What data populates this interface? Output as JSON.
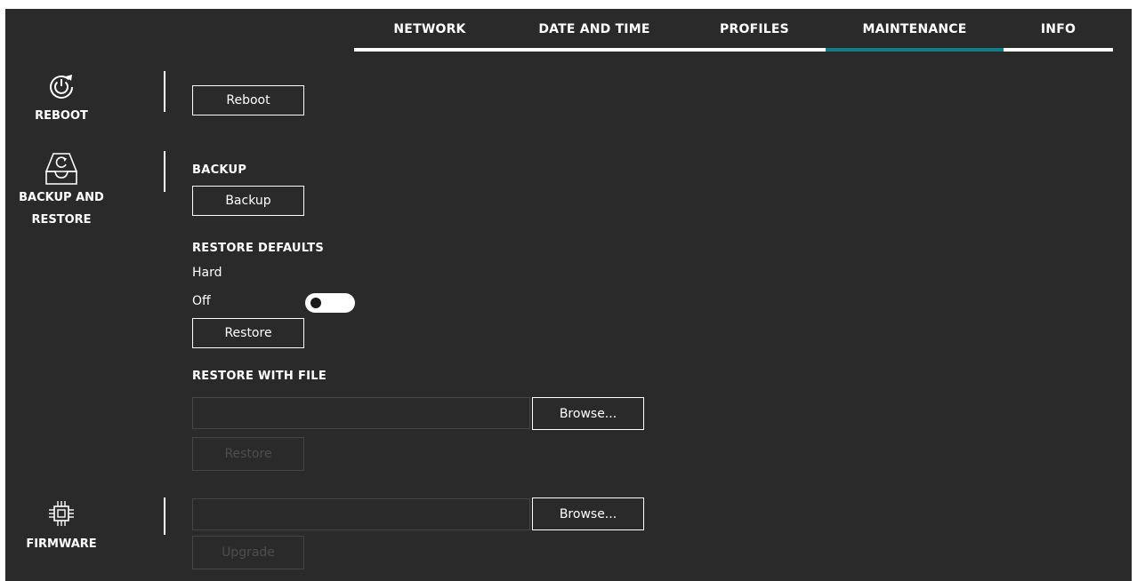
{
  "tabs": [
    {
      "label": "NETWORK",
      "active": false
    },
    {
      "label": "DATE AND TIME",
      "active": false
    },
    {
      "label": "PROFILES",
      "active": false
    },
    {
      "label": "MAINTENANCE",
      "active": true
    },
    {
      "label": "INFO",
      "active": false
    }
  ],
  "sidebar": {
    "reboot": {
      "label": "REBOOT",
      "icon": "power-restart-icon"
    },
    "backup_restore": {
      "label_line1": "BACKUP AND",
      "label_line2": "RESTORE",
      "icon": "inbox-restore-icon"
    },
    "firmware": {
      "label": "FIRMWARE",
      "icon": "chip-icon"
    }
  },
  "reboot": {
    "button": "Reboot"
  },
  "backup": {
    "heading": "BACKUP",
    "button": "Backup"
  },
  "restore_defaults": {
    "heading": "RESTORE DEFAULTS",
    "option_label": "Hard",
    "state_text": "Off",
    "toggle_on": false,
    "button": "Restore"
  },
  "restore_with_file": {
    "heading": "RESTORE WITH FILE",
    "file_value": "",
    "browse_button": "Browse...",
    "restore_button": "Restore"
  },
  "firmware": {
    "file_value": "",
    "browse_button": "Browse...",
    "upgrade_button": "Upgrade"
  },
  "colors": {
    "background": "#2a2a2b",
    "accent": "#137b86",
    "text": "#ffffff",
    "disabled": "#4e4e4f"
  }
}
